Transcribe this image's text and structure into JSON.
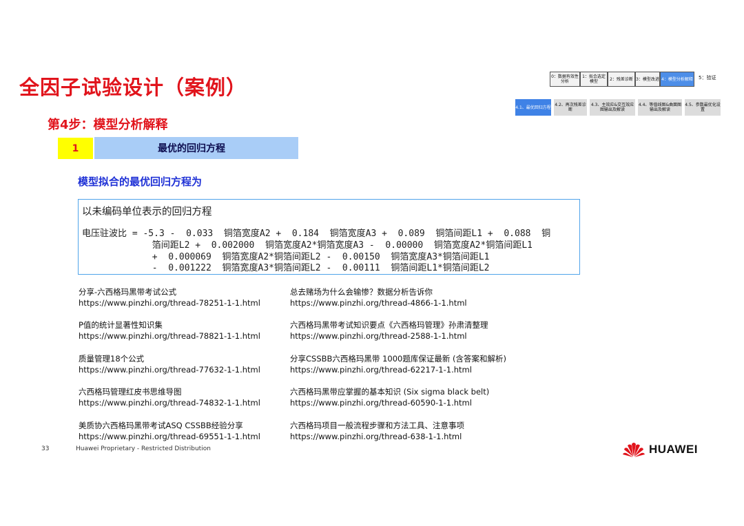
{
  "slide": {
    "title": "全因子试验设计（案例）",
    "subtitle": "第4步：模型分析解释",
    "section_number": "1",
    "section_title": "最优的回归方程",
    "fit_label": "模型拟合的最优回归方程为"
  },
  "equation": {
    "heading": "以未编码单位表示的回归方程",
    "lines": [
      "电压驻波比 = -5.3 -  0.033  铜箔宽度A2 +  0.184  铜箔宽度A3 +  0.089  铜箔间距L1 +  0.088  铜",
      "             箔间距L2 +  0.002000  铜箔宽度A2*铜箔宽度A3 -  0.00000  铜箔宽度A2*铜箔间距L1",
      "             +  0.000069  铜箔宽度A2*铜箔间距L2 -  0.00150  铜箔宽度A3*铜箔间距L1",
      "             -  0.001222  铜箔宽度A3*铜箔间距L2 -  0.00111  铜箔间距L1*铜箔间距L2"
    ]
  },
  "links_left": [
    {
      "title": "分享-六西格玛黑带考试公式",
      "url": "https://www.pinzhi.org/thread-78251-1-1.html"
    },
    {
      "title": "P值的统计显著性知识集",
      "url": "https://www.pinzhi.org/thread-78821-1-1.html"
    },
    {
      "title": "质量管理18个公式",
      "url": "https://www.pinzhi.org/thread-77632-1-1.html"
    },
    {
      "title": "六西格玛管理红皮书思维导图",
      "url": "https://www.pinzhi.org/thread-74832-1-1.html"
    },
    {
      "title": "美质协六西格玛黑带考试ASQ CSSBB经验分享",
      "url": "https://www.pinzhi.org/thread-69551-1-1.html"
    }
  ],
  "links_right": [
    {
      "title": "总去赌场为什么会输惨？数据分析告诉你",
      "url": "https://www.pinzhi.org/thread-4866-1-1.html"
    },
    {
      "title": "六西格玛黑带考试知识要点《六西格玛管理》孙肃清整理",
      "url": "https://www.pinzhi.org/thread-2588-1-1.html"
    },
    {
      "title": "分享CSSBB六西格玛黑带 1000题库保证最新 (含答案和解析)",
      "url": "https://www.pinzhi.org/thread-62217-1-1.html"
    },
    {
      "title": "六西格玛黑带应掌握的基本知识 (Six sigma black belt)",
      "url": "https://www.pinzhi.org/thread-60590-1-1.html"
    },
    {
      "title": "六西格玛项目一般流程步骤和方法工具、注意事项",
      "url": "https://www.pinzhi.org/thread-638-1-1.html"
    }
  ],
  "process": {
    "chevrons": [
      {
        "label": "0：数据有效性分析"
      },
      {
        "label": "1：拟合选定模型"
      },
      {
        "label": "2：残差诊断"
      },
      {
        "label": "3：模型改进"
      },
      {
        "label": "4：模型分析解释"
      }
    ],
    "verify": "5：验证",
    "steps": [
      {
        "label": "4.1、最优回归方程"
      },
      {
        "label": "4.2、再次残差诊断"
      },
      {
        "label": "4.3、主效应&交互效应图输出及解读"
      },
      {
        "label": "4.4、等值线图&曲面图输出及解读"
      },
      {
        "label": "4.5、参数最优化设置"
      }
    ]
  },
  "footer": {
    "page_number": "33",
    "text": "Huawei Proprietary - Restricted Distribution",
    "logo": "HUAWEI"
  },
  "colors": {
    "title_red": "#e1141c",
    "highlight_yellow": "#ffff00",
    "bar_blue": "#a9cdf7",
    "fit_label_blue": "#1f31d6",
    "active_step_blue": "#3f82e6"
  }
}
